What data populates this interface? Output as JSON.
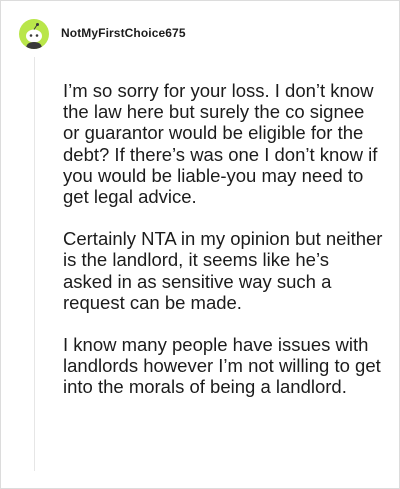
{
  "comment": {
    "username": "NotMyFirstChoice675",
    "avatar_icon": "reddit-snoo-avatar-icon",
    "avatar_color": "#b9e64a",
    "paragraphs": [
      "I’m so sorry for your loss. I don’t know the law here but surely the co signee or guarantor would be eligible for the debt? If there’s was one I don’t know if you would be liable-you may need to get legal advice.",
      "Certainly NTA in my opinion but neither is the landlord, it seems like he’s asked in as sensitive way such a request can be made.",
      "I know many people have issues with landlords however I’m not willing to get into the morals of being a landlord."
    ]
  }
}
